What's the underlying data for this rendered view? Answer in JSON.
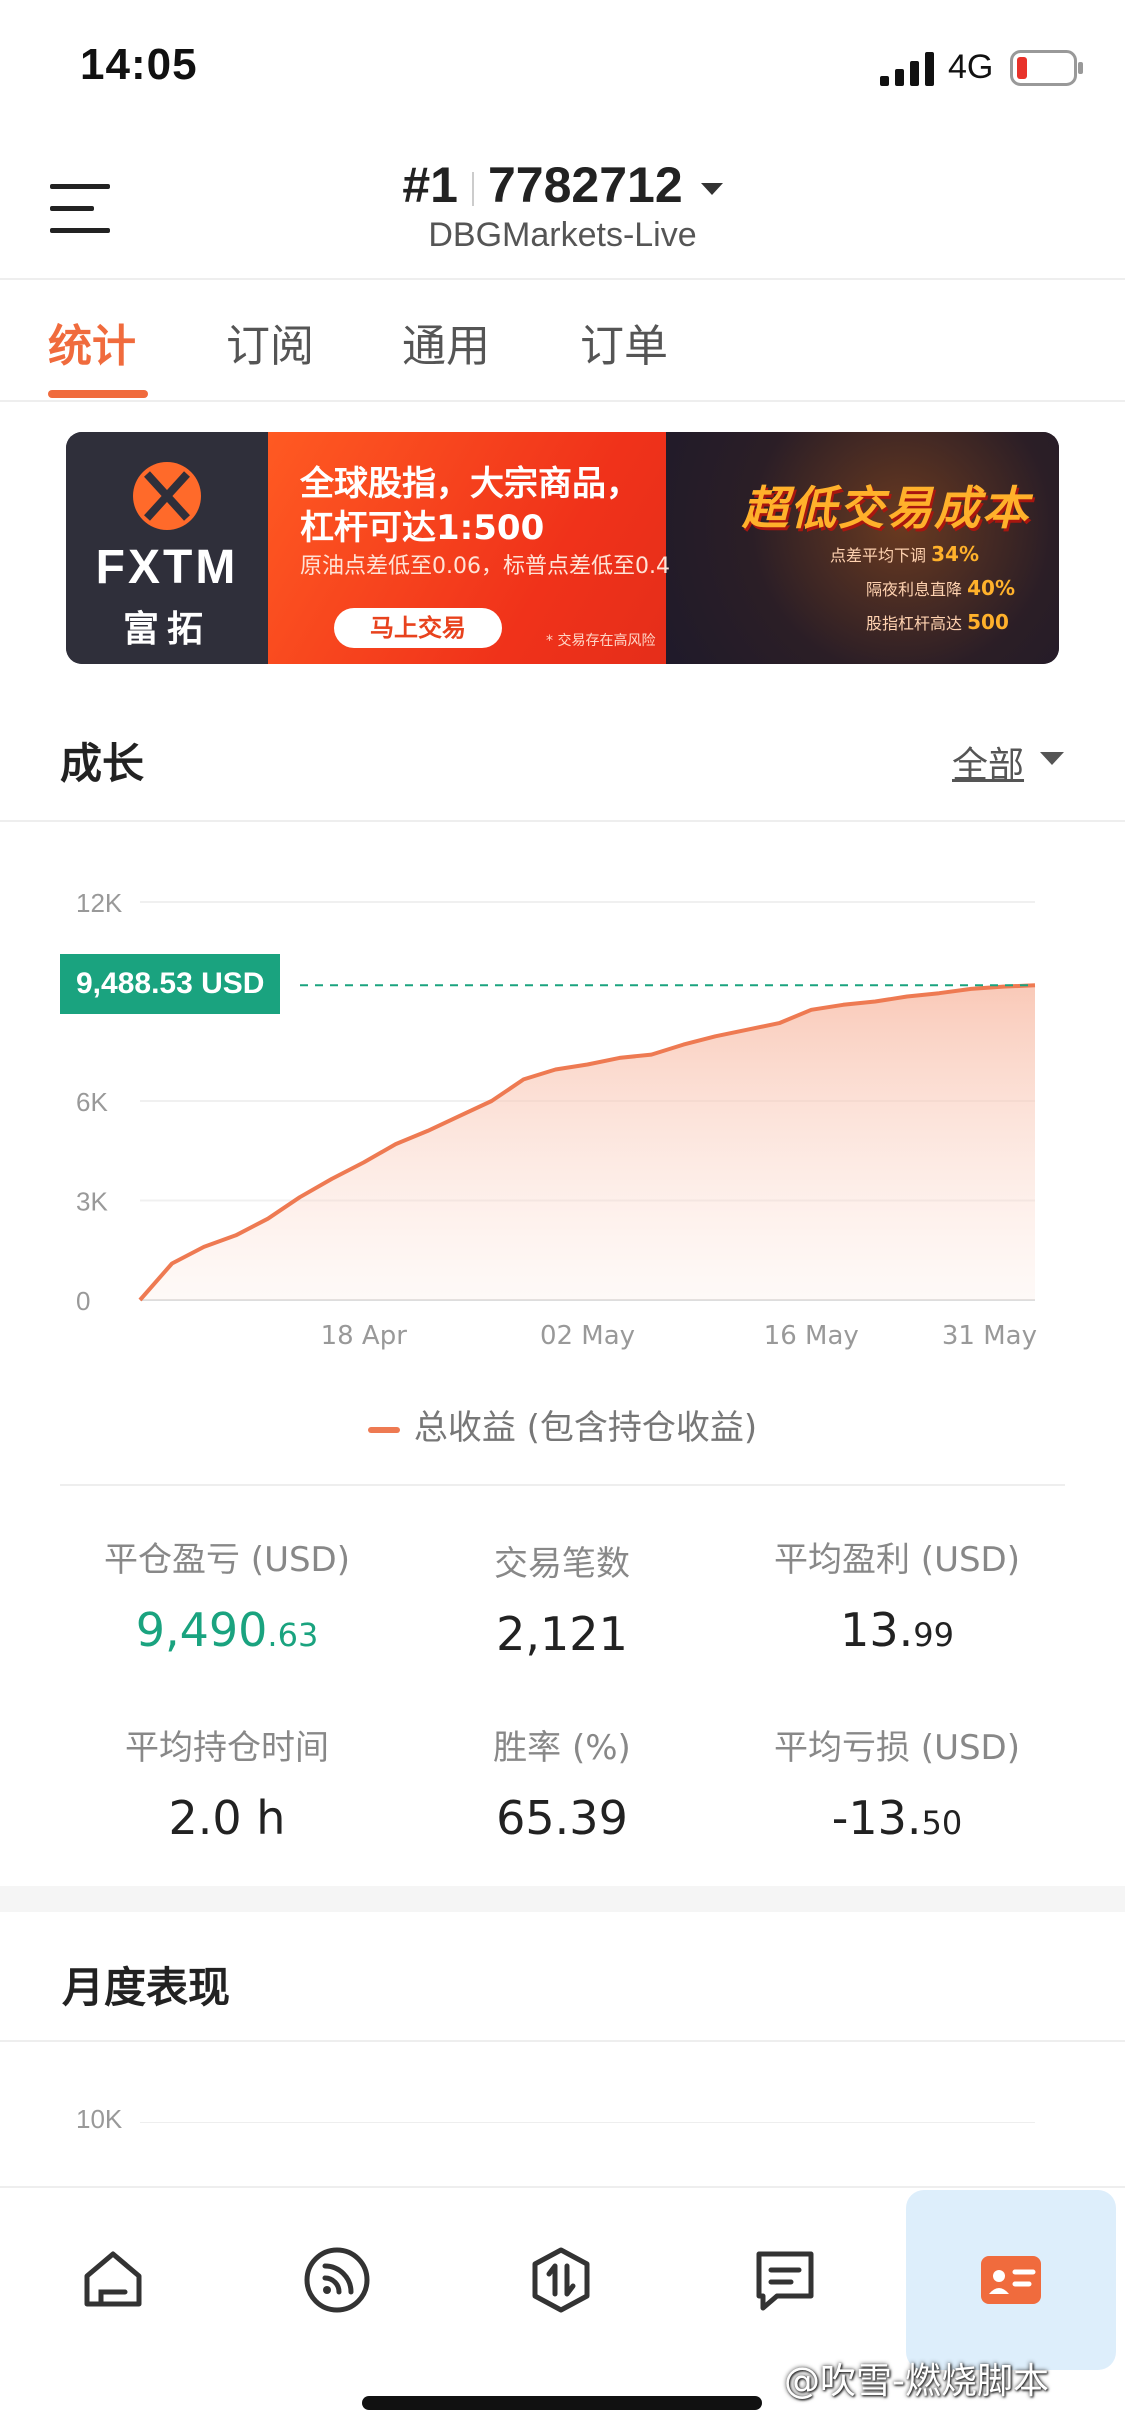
{
  "status_bar": {
    "time": "14:05",
    "network": "4G"
  },
  "header": {
    "account_prefix": "#1",
    "account_number": "7782712",
    "server": "DBGMarkets-Live"
  },
  "tabs": [
    {
      "label": "统计",
      "active": true
    },
    {
      "label": "订阅",
      "active": false
    },
    {
      "label": "通用",
      "active": false
    },
    {
      "label": "订单",
      "active": false
    }
  ],
  "banner": {
    "brand": "FXTM",
    "brand_cn": "富拓",
    "title_line1": "全球股指，大宗商品，",
    "title_line2": "杠杆可达1:500",
    "subtitle": "原油点差低至0.06，标普点差低至0.4",
    "cta": "马上交易",
    "risk_note": "* 交易存在高风险",
    "slogan": "超低交易成本",
    "lines": [
      {
        "text": "点差平均下调",
        "value": "34%"
      },
      {
        "text": "隔夜利息直降",
        "value": "40%"
      },
      {
        "text": "股指杠杆高达",
        "value": "500"
      }
    ]
  },
  "growth_section": {
    "title": "成长",
    "filter_label": "全部",
    "current_value_tag": "9,488.53 USD",
    "legend_label": "总收益 (包含持仓收益)"
  },
  "chart_data": {
    "type": "area",
    "x_ticks": [
      "18 Apr",
      "02 May",
      "16 May",
      "31 May"
    ],
    "y_ticks": [
      "0",
      "3K",
      "6K",
      "12K"
    ],
    "ylim": [
      0,
      12000
    ],
    "current_value": 9488.53,
    "series": [
      {
        "name": "总收益 (包含持仓收益)",
        "color": "#ee7a52",
        "x": [
          "04 Apr",
          "06 Apr",
          "08 Apr",
          "10 Apr",
          "12 Apr",
          "14 Apr",
          "16 Apr",
          "18 Apr",
          "20 Apr",
          "22 Apr",
          "24 Apr",
          "26 Apr",
          "28 Apr",
          "30 Apr",
          "02 May",
          "04 May",
          "06 May",
          "08 May",
          "10 May",
          "12 May",
          "14 May",
          "16 May",
          "18 May",
          "20 May",
          "22 May",
          "24 May",
          "26 May",
          "28 May",
          "31 May"
        ],
        "values": [
          0,
          1100,
          1600,
          1950,
          2450,
          3100,
          3650,
          4150,
          4700,
          5100,
          5550,
          6000,
          6650,
          6950,
          7100,
          7300,
          7400,
          7700,
          7950,
          8150,
          8350,
          8750,
          8900,
          9000,
          9150,
          9250,
          9380,
          9450,
          9488
        ]
      }
    ],
    "grid": true,
    "legend_position": "bottom"
  },
  "stats": [
    {
      "label": "平仓盈亏 (USD)",
      "value_main": "9,490",
      "value_small": ".63",
      "color": "#1aa37f"
    },
    {
      "label": "交易笔数",
      "value_main": "2,121",
      "value_small": ""
    },
    {
      "label": "平均盈利 (USD)",
      "value_main": "13.",
      "value_small": "99"
    },
    {
      "label": "平均持仓时间",
      "value_main": "2.0 h",
      "value_small": ""
    },
    {
      "label": "胜率 (%)",
      "value_main": "65.39",
      "value_small": ""
    },
    {
      "label": "平均亏损 (USD)",
      "value_main": "-13.",
      "value_small": "50"
    }
  ],
  "monthly_section": {
    "title": "月度表现",
    "y_tick_top": "10K"
  },
  "bottom_nav": [
    {
      "icon": "home-icon",
      "active": false
    },
    {
      "icon": "signal-feed-icon",
      "active": false
    },
    {
      "icon": "trade-icon",
      "active": false
    },
    {
      "icon": "message-icon",
      "active": false
    },
    {
      "icon": "profile-card-icon",
      "active": true
    }
  ],
  "watermark": "@吹雪-燃烧脚本",
  "colors": {
    "accent": "#f06b3d",
    "profit": "#1aa37f",
    "line": "#ee7a52"
  }
}
